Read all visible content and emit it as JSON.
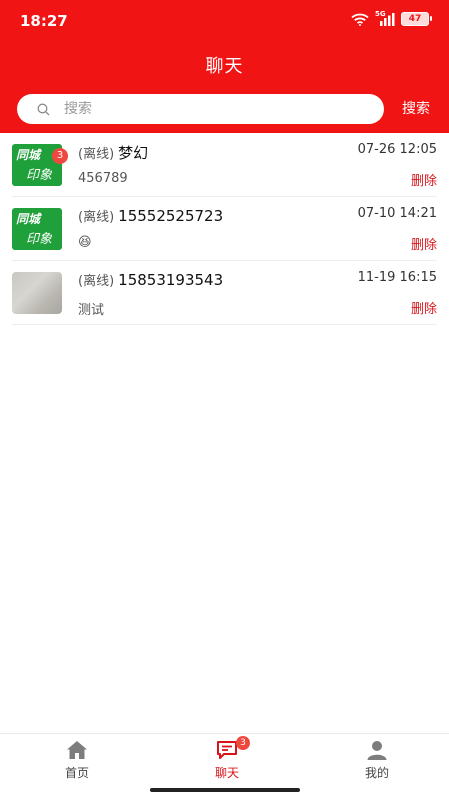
{
  "status_bar": {
    "time": "18:27",
    "battery": "47",
    "network": "5G"
  },
  "header": {
    "title": "聊天"
  },
  "search": {
    "placeholder": "搜索",
    "button_label": "搜索"
  },
  "chats": [
    {
      "status": "(离线)",
      "name": "梦幻",
      "time": "07-26 12:05",
      "preview": "456789",
      "delete_label": "删除",
      "unread": "3",
      "avatar": "tongcheng-logo"
    },
    {
      "status": "(离线)",
      "name": "15552525723",
      "time": "07-10 14:21",
      "preview": "😆",
      "delete_label": "删除",
      "avatar": "tongcheng-logo"
    },
    {
      "status": "(离线)",
      "name": "15853193543",
      "time": "11-19 16:15",
      "preview": "测试",
      "delete_label": "删除",
      "avatar": "photo-thumbnail"
    }
  ],
  "avatar_logo": {
    "top": "同城",
    "bottom": "印象"
  },
  "tabs": [
    {
      "label": "首页",
      "icon": "home-icon"
    },
    {
      "label": "聊天",
      "icon": "chat-icon",
      "badge": "3",
      "active": true
    },
    {
      "label": "我的",
      "icon": "user-icon"
    }
  ],
  "colors": {
    "brand_red": "#f01414",
    "delete_red": "#d8141a",
    "avatar_green": "#1fa03a",
    "badge_red": "#f0483e"
  }
}
